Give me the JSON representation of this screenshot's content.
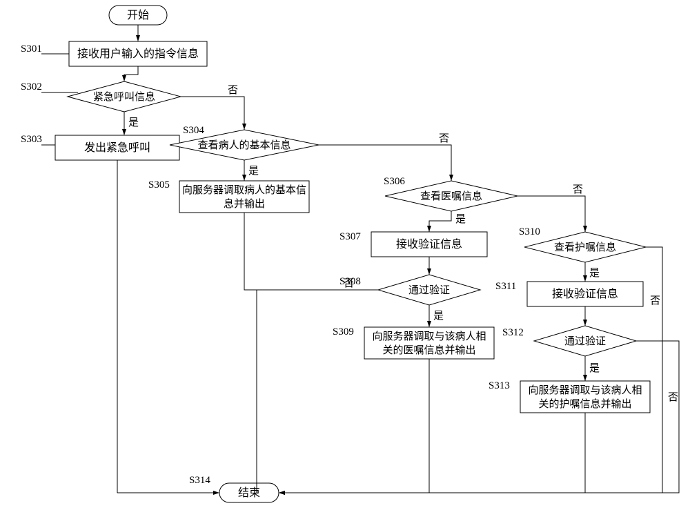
{
  "chart_data": {
    "type": "flowchart",
    "title": "",
    "nodes": {
      "start": {
        "kind": "terminator",
        "text": "开始"
      },
      "end": {
        "kind": "terminator",
        "text": "结束"
      },
      "s301": {
        "kind": "process",
        "text": "接收用户输入的指令信息"
      },
      "s302": {
        "kind": "decision",
        "text": "紧急呼叫信息"
      },
      "s303": {
        "kind": "process",
        "text": "发出紧急呼叫"
      },
      "s304": {
        "kind": "decision",
        "text": "查看病人的基本信息"
      },
      "s305": {
        "kind": "process",
        "text": "向服务器调取病人的基本信息并输出"
      },
      "s306": {
        "kind": "decision",
        "text": "查看医嘱信息"
      },
      "s307": {
        "kind": "process",
        "text": "接收验证信息"
      },
      "s308": {
        "kind": "decision",
        "text": "通过验证"
      },
      "s309": {
        "kind": "process",
        "text": "向服务器调取与该病人相关的医嘱信息并输出"
      },
      "s310": {
        "kind": "decision",
        "text": "查看护嘱信息"
      },
      "s311": {
        "kind": "process",
        "text": "接收验证信息"
      },
      "s312": {
        "kind": "decision",
        "text": "通过验证"
      },
      "s313": {
        "kind": "process",
        "text": "向服务器调取与该病人相关的护嘱信息并输出"
      }
    },
    "step_ids": {
      "s301": "S301",
      "s302": "S302",
      "s303": "S303",
      "s304": "S304",
      "s305": "S305",
      "s306": "S306",
      "s307": "S307",
      "s308": "S308",
      "s309": "S309",
      "s310": "S310",
      "s311": "S311",
      "s312": "S312",
      "s313": "S313",
      "s314": "S314"
    },
    "branch_labels": {
      "yes": "是",
      "no": "否"
    },
    "edges": [
      [
        "start",
        "s301",
        null
      ],
      [
        "s301",
        "s302",
        null
      ],
      [
        "s302",
        "s303",
        "yes"
      ],
      [
        "s302",
        "s304",
        "no"
      ],
      [
        "s304",
        "s305",
        "yes"
      ],
      [
        "s304",
        "s306",
        "no"
      ],
      [
        "s306",
        "s307",
        "yes"
      ],
      [
        "s306",
        "s310",
        "no"
      ],
      [
        "s307",
        "s308",
        null
      ],
      [
        "s308",
        "s309",
        "yes"
      ],
      [
        "s308",
        "end",
        "no"
      ],
      [
        "s310",
        "s311",
        "yes"
      ],
      [
        "s310",
        "end",
        "no"
      ],
      [
        "s311",
        "s312",
        null
      ],
      [
        "s312",
        "s313",
        "yes"
      ],
      [
        "s312",
        "end",
        "no"
      ],
      [
        "s303",
        "end",
        null
      ],
      [
        "s305",
        "end",
        null
      ],
      [
        "s309",
        "end",
        null
      ],
      [
        "s313",
        "end",
        null
      ]
    ]
  }
}
